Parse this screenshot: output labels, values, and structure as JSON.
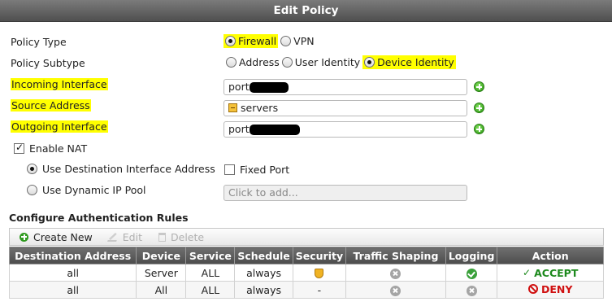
{
  "window": {
    "title": "Edit Policy"
  },
  "form": {
    "policy_type": {
      "label": "Policy Type",
      "options": [
        "Firewall",
        "VPN"
      ],
      "selected": "Firewall"
    },
    "policy_subtype": {
      "label": "Policy Subtype",
      "options": [
        "Address",
        "User Identity",
        "Device Identity"
      ],
      "selected": "Device Identity"
    },
    "incoming_interface": {
      "label": "Incoming Interface",
      "value": "port"
    },
    "source_address": {
      "label": "Source Address",
      "value": "servers"
    },
    "outgoing_interface": {
      "label": "Outgoing Interface",
      "value": "port"
    },
    "enable_nat": {
      "label": "Enable NAT",
      "checked": true
    },
    "use_dest_interface": {
      "label": "Use Destination Interface Address"
    },
    "fixed_port": {
      "label": "Fixed Port",
      "checked": false
    },
    "use_dynamic_pool": {
      "label": "Use Dynamic IP Pool",
      "placeholder": "Click to add..."
    }
  },
  "auth_rules": {
    "title": "Configure Authentication Rules",
    "toolbar": {
      "create": "Create New",
      "edit": "Edit",
      "delete": "Delete"
    },
    "columns": [
      "Destination Address",
      "Device",
      "Service",
      "Schedule",
      "Security",
      "Traffic Shaping",
      "Logging",
      "Action"
    ],
    "rows": [
      {
        "destination": "all",
        "device": "Server",
        "service": "ALL",
        "schedule": "always",
        "security": "shield-icon",
        "traffic_shaping": "disabled-icon",
        "logging": "enabled-icon",
        "action": "ACCEPT"
      },
      {
        "destination": "all",
        "device": "All",
        "service": "ALL",
        "schedule": "always",
        "security": "-",
        "traffic_shaping": "disabled-icon",
        "logging": "disabled-icon",
        "action": "DENY"
      }
    ]
  },
  "colors": {
    "highlight": "#ffff00",
    "accept": "#1e8a1e",
    "deny": "#d01010",
    "header": "#5a5a5a"
  }
}
